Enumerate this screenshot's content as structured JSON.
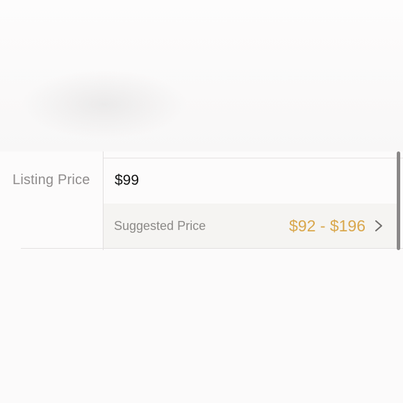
{
  "listing": {
    "label": "Listing Price",
    "value": "$99"
  },
  "suggested": {
    "label": "Suggested Price",
    "range": "$92 - $196",
    "icon": "chevron-right-icon"
  },
  "colors": {
    "accent": "#d9a74c",
    "label_gray": "#8f8c8c",
    "value_black": "#141414",
    "row_background": "#f5f4f2"
  }
}
